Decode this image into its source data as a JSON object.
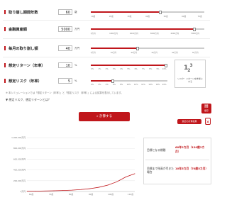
{
  "rows": [
    {
      "label": "取り崩し期間年数",
      "value": "60",
      "unit": "歳",
      "min": 0,
      "max": 100,
      "current": 60,
      "ticks": [
        "10歳",
        "20歳",
        "30歳",
        "40歳",
        "50歳",
        "60歳",
        "70歳"
      ]
    },
    {
      "label": "金融資産額",
      "value": "5000",
      "unit": "万円",
      "min": 0,
      "max": 10000,
      "current": 5000,
      "ticks": [
        "0万円",
        "1000万円",
        "2000万円",
        "3000万円",
        "4000万円",
        "5000万円"
      ]
    },
    {
      "label": "毎月の取り崩し額",
      "value": "40",
      "unit": "万円",
      "min": 0,
      "max": 100,
      "current": 40,
      "ticks": [
        "0万円",
        "10万円",
        "20万円",
        "30万円",
        "40万円",
        "50万円"
      ]
    },
    {
      "label": "想定リターン（年率）",
      "value": "10",
      "unit": "%",
      "min": 0,
      "max": 10,
      "current": 10,
      "ticks": [
        "0%",
        "1%",
        "2%",
        "3%",
        "4%",
        "5%",
        "6%",
        "7%",
        "8%",
        "9%",
        "10%"
      ]
    },
    {
      "label": "想定リスク（年率）",
      "value": "5",
      "unit": "%",
      "min": 0,
      "max": 20,
      "current": 5,
      "ticks": [
        "0%",
        "2%",
        "4%",
        "6%",
        "8%",
        "10%",
        "12%",
        "14%",
        "16%",
        "18%",
        "20%"
      ]
    }
  ],
  "side_box_caption": "リスク・リターンを参考にする",
  "footnote": "※ 本シミュレーションでは「想定リターン（年率）」と「想定リスク（年率）」による試算を表示しています。",
  "link_text": "▼ 想定リスク、想定リターンとは？",
  "calc_button": "» 計算する",
  "side_tab_label": "保存",
  "side_button_label": "過去の計算結果",
  "results": [
    {
      "label": "目標となる期間",
      "value": "60年2カ月（120歳2カ月）"
    },
    {
      "label": "目標まで残高が尽きた場合",
      "value": "10年5カ月（70歳5カ月）"
    }
  ],
  "chart_data": {
    "type": "line",
    "y_ticks": [
      "1,000,000万円",
      "800,000万円",
      "600,000万円",
      "400,000万円",
      "200,000万円",
      "0万円"
    ],
    "x_ticks": [
      "60歳",
      "70歳",
      "80歳",
      "90歳",
      "100歳",
      "110歳"
    ],
    "x": [
      60,
      65,
      70,
      75,
      80,
      85,
      90,
      95,
      100,
      105,
      110,
      115,
      120
    ],
    "values": [
      5000,
      7000,
      9500,
      13000,
      18000,
      25000,
      36000,
      52000,
      78000,
      118000,
      180000,
      270000,
      330000
    ],
    "ylim": [
      0,
      1000000
    ],
    "xlim": [
      60,
      120
    ],
    "color": "#c0161b"
  },
  "colors": {
    "accent": "#c0161b",
    "track": "#cccccc"
  }
}
